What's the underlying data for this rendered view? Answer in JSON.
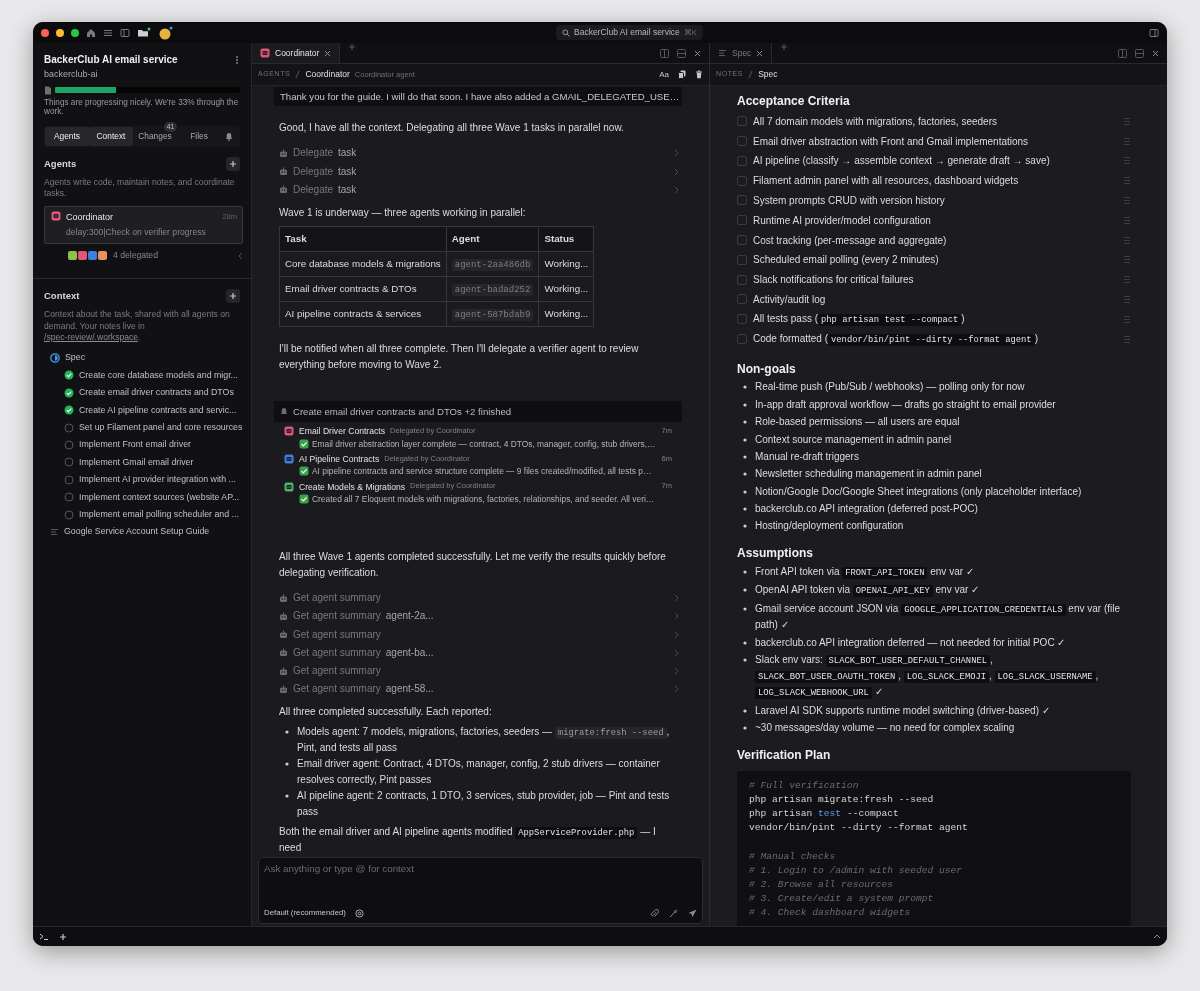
{
  "window": {
    "title": "BackerClub AI email service",
    "shortcut": "⌘K"
  },
  "sidebar": {
    "project": "BackerClub AI email service",
    "slug": "backerclub-ai",
    "progress": {
      "level": 0.33
    },
    "note": "Things are progressing nicely. We're 33% through the work.",
    "tabs": [
      {
        "label": "Agents",
        "selected": true
      },
      {
        "label": "Context",
        "selected": true
      },
      {
        "label": "Changes",
        "badge": "41",
        "selected": false
      },
      {
        "label": "Files",
        "selected": false
      }
    ],
    "agents": {
      "title": "Agents",
      "description": "Agents write code, maintain notes, and coordinate tasks.",
      "items": [
        {
          "name": "Coordinator",
          "time": "28m",
          "status": "delay:300|Check on verifier progress",
          "selected": true
        }
      ],
      "delegates": [
        {
          "color": "#8bc34a"
        },
        {
          "color": "#e0557a"
        },
        {
          "color": "#3d7fe0"
        },
        {
          "color": "#e8915a"
        }
      ],
      "delegated": "4 delegated"
    },
    "context": {
      "title": "Context",
      "description": "Context about the task, shared with all agents on demand. Your notes live in ",
      "link": "/spec-review/.workspace",
      "description_end": ".",
      "tree": [
        {
          "kind": "spec",
          "label": "Spec",
          "children": [
            {
              "label": "Create core database models and migr...",
              "done": true
            },
            {
              "label": "Create email driver contracts and DTOs",
              "done": true
            },
            {
              "label": "Create AI pipeline contracts and servic...",
              "done": true
            },
            {
              "label": "Set up Filament panel and core resources",
              "done": false
            },
            {
              "label": "Implement Front email driver",
              "done": false
            },
            {
              "label": "Implement Gmail email driver",
              "done": false
            },
            {
              "label": "Implement AI provider integration with ...",
              "done": false
            },
            {
              "label": "Implement context sources (website AP...",
              "done": false
            },
            {
              "label": "Implement email polling scheduler and ...",
              "done": false
            }
          ]
        },
        {
          "kind": "note",
          "label": "Google Service Account Setup Guide"
        }
      ]
    }
  },
  "chat": {
    "tab": "Coordinator",
    "breadcrumb": {
      "section": "AGENTS",
      "current": "Coordinator",
      "subtitle": "Coordinator agent"
    },
    "font_toggle": "Aa",
    "pinned": "Thank you for the guide. I will do that soon. I have also added a GMAIL_DELEGATED_USE…",
    "messages": [
      {
        "kind": "text",
        "text": "Good, I have all the context. Delegating all three Wave 1 tasks in parallel now."
      },
      {
        "kind": "tool",
        "name": "Delegate",
        "arg": "task"
      },
      {
        "kind": "tool",
        "name": "Delegate",
        "arg": "task"
      },
      {
        "kind": "tool",
        "name": "Delegate",
        "arg": "task"
      },
      {
        "kind": "text",
        "text": "Wave 1 is underway — three agents working in parallel:"
      },
      {
        "kind": "table",
        "columns": [
          "Task",
          "Agent",
          "Status"
        ],
        "rows": [
          [
            "Core database models & migrations",
            "agent-2aa486db",
            "Working..."
          ],
          [
            "Email driver contracts & DTOs",
            "agent-badad252",
            "Working..."
          ],
          [
            "AI pipeline contracts & services",
            "agent-587bdab9",
            "Working..."
          ]
        ]
      },
      {
        "kind": "text",
        "text": "I'll be notified when all three complete. Then I'll delegate a verifier agent to review everything before moving to Wave 2."
      },
      {
        "kind": "notification",
        "title": "Create email driver contracts and DTOs +2 finished",
        "items": [
          {
            "name": "Email Driver Contracts",
            "by": "Delegated by Coordinator",
            "time": "7m",
            "summary": "Email driver abstraction layer complete — contract, 4 DTOs, manager, config, stub drivers,…",
            "color": "#e0557a"
          },
          {
            "name": "AI Pipeline Contracts",
            "by": "Delegated by Coordinator",
            "time": "6m",
            "summary": "AI pipeline contracts and service structure complete — 9 files created/modified, all tests p…",
            "color": "#3d7fe0"
          },
          {
            "name": "Create Models & Migrations",
            "by": "Delegated by Coordinator",
            "time": "7m",
            "summary": "Created all 7 Eloquent models with migrations, factories, relationships, and seeder. All veri…",
            "color": "#4caf6a"
          }
        ]
      },
      {
        "kind": "text",
        "text": "All three Wave 1 agents completed successfully. Let me verify the results quickly before delegating verification."
      },
      {
        "kind": "tool",
        "name": "Get agent summary"
      },
      {
        "kind": "tool",
        "name": "Get agent summary",
        "arg": "agent-2a..."
      },
      {
        "kind": "tool",
        "name": "Get agent summary"
      },
      {
        "kind": "tool",
        "name": "Get agent summary",
        "arg": "agent-ba..."
      },
      {
        "kind": "tool",
        "name": "Get agent summary"
      },
      {
        "kind": "tool",
        "name": "Get agent summary",
        "arg": "agent-58..."
      },
      {
        "kind": "text",
        "text": "All three completed successfully. Each reported:"
      },
      {
        "kind": "list",
        "items": [
          {
            "parts": [
              {
                "kind": "text",
                "text": "Models agent: 7 models, migrations, factories, seeders — "
              },
              {
                "kind": "code",
                "text": "migrate:fresh --seed"
              },
              {
                "kind": "text",
                "text": ", Pint, and tests all pass"
              }
            ]
          },
          {
            "text": "Email driver agent: Contract, 4 DTOs, manager, config, 2 stub drivers — container resolves correctly, Pint passes"
          },
          {
            "text": "AI pipeline agent: 2 contracts, 1 DTO, 3 services, stub provider, job — Pint and tests pass"
          }
        ]
      },
      {
        "kind": "text",
        "parts": [
          {
            "kind": "text",
            "text": "Both the email driver and AI pipeline agents modified "
          },
          {
            "kind": "code",
            "text": "AppServiceProvider.php"
          },
          {
            "kind": "text",
            "text": " — I need"
          }
        ]
      }
    ],
    "composer": {
      "placeholder": "Ask anything or type @ for context",
      "mode": "Default (recommended)"
    }
  },
  "notes": {
    "tab": "Spec",
    "breadcrumb": {
      "section": "NOTES",
      "current": "Spec"
    },
    "sections": [
      {
        "heading": "Acceptance Criteria",
        "kind": "checklist",
        "items": [
          {
            "text": "All 7 domain models with migrations, factories, seeders",
            "checked": false
          },
          {
            "text": "Email driver abstraction with Front and Gmail implementations",
            "checked": false
          },
          {
            "text": "AI pipeline (classify → assemble context → generate draft → save)",
            "checked": false
          },
          {
            "text": "Filament admin panel with all resources, dashboard widgets",
            "checked": false
          },
          {
            "text": "System prompts CRUD with version history",
            "checked": false
          },
          {
            "text": "Runtime AI provider/model configuration",
            "checked": false
          },
          {
            "text": "Cost tracking (per-message and aggregate)",
            "checked": false
          },
          {
            "text": "Scheduled email polling (every 2 minutes)",
            "checked": false
          },
          {
            "text": "Slack notifications for critical failures",
            "checked": false
          },
          {
            "text": "Activity/audit log",
            "checked": false
          },
          {
            "parts": [
              {
                "kind": "text",
                "text": "All tests pass ("
              },
              {
                "kind": "code",
                "text": "php artisan test --compact"
              },
              {
                "kind": "text",
                "text": ")"
              }
            ],
            "checked": false
          },
          {
            "parts": [
              {
                "kind": "text",
                "text": "Code formatted ("
              },
              {
                "kind": "code",
                "text": "vendor/bin/pint --dirty --format agent"
              },
              {
                "kind": "text",
                "text": ")"
              }
            ],
            "checked": false
          }
        ]
      },
      {
        "heading": "Non-goals",
        "kind": "bullets",
        "items": [
          {
            "text": "Real-time push (Pub/Sub / webhooks) — polling only for now"
          },
          {
            "text": "In-app draft approval workflow — drafts go straight to email provider"
          },
          {
            "text": "Role-based permissions — all users are equal"
          },
          {
            "text": "Context source management in admin panel"
          },
          {
            "text": "Manual re-draft triggers"
          },
          {
            "text": "Newsletter scheduling management in admin panel"
          },
          {
            "text": "Notion/Google Doc/Google Sheet integrations (only placeholder interface)"
          },
          {
            "text": "backerclub.co API integration (deferred post-POC)"
          },
          {
            "text": "Hosting/deployment configuration"
          }
        ]
      },
      {
        "heading": "Assumptions",
        "kind": "bullets",
        "items": [
          {
            "parts": [
              {
                "kind": "text",
                "text": "Front API token via "
              },
              {
                "kind": "code",
                "text": "FRONT_API_TOKEN"
              },
              {
                "kind": "text",
                "text": " env var ✓"
              }
            ]
          },
          {
            "parts": [
              {
                "kind": "text",
                "text": "OpenAI API token via "
              },
              {
                "kind": "code",
                "text": "OPENAI_API_KEY"
              },
              {
                "kind": "text",
                "text": " env var ✓"
              }
            ]
          },
          {
            "parts": [
              {
                "kind": "text",
                "text": "Gmail service account JSON via "
              },
              {
                "kind": "code",
                "text": "GOOGLE_APPLICATION_CREDENTIALS"
              },
              {
                "kind": "text",
                "text": " env var (file path) ✓"
              }
            ]
          },
          {
            "text": "backerclub.co API integration deferred — not needed for initial POC ✓"
          },
          {
            "parts": [
              {
                "kind": "text",
                "text": "Slack env vars: "
              },
              {
                "kind": "code",
                "text": "SLACK_BOT_USER_DEFAULT_CHANNEL"
              },
              {
                "kind": "text",
                "text": ", "
              },
              {
                "kind": "code",
                "text": "SLACK_BOT_USER_OAUTH_TOKEN"
              },
              {
                "kind": "text",
                "text": ", "
              },
              {
                "kind": "code",
                "text": "LOG_SLACK_EMOJI"
              },
              {
                "kind": "text",
                "text": ", "
              },
              {
                "kind": "code",
                "text": "LOG_SLACK_USERNAME"
              },
              {
                "kind": "text",
                "text": ", "
              },
              {
                "kind": "code",
                "text": "LOG_SLACK_WEBHOOK_URL"
              },
              {
                "kind": "text",
                "text": " ✓"
              }
            ]
          },
          {
            "text": "Laravel AI SDK supports runtime model switching (driver-based) ✓"
          },
          {
            "text": "~30 messages/day volume — no need for complex scaling"
          }
        ]
      },
      {
        "heading": "Verification Plan",
        "kind": "code",
        "groups": [
          [
            [
              {
                "kind": "comment",
                "text": "# Full verification"
              }
            ],
            [
              {
                "kind": "plain",
                "text": "php artisan migrate:fresh --seed"
              }
            ],
            [
              {
                "kind": "plain",
                "text": "php artisan "
              },
              {
                "kind": "keyword",
                "text": "test"
              },
              {
                "kind": "plain",
                "text": " --compact"
              }
            ],
            [
              {
                "kind": "plain",
                "text": "vendor/bin/pint --dirty --format agent"
              }
            ]
          ],
          [
            [
              {
                "kind": "comment",
                "text": "# Manual checks"
              }
            ],
            [
              {
                "kind": "comment",
                "text": "# 1. Login to /admin with seeded user"
              }
            ],
            [
              {
                "kind": "comment",
                "text": "# 2. Browse all resources"
              }
            ],
            [
              {
                "kind": "comment",
                "text": "# 3. Create/edit a system prompt"
              }
            ],
            [
              {
                "kind": "comment",
                "text": "# 4. Check dashboard widgets"
              }
            ]
          ]
        ]
      }
    ]
  }
}
